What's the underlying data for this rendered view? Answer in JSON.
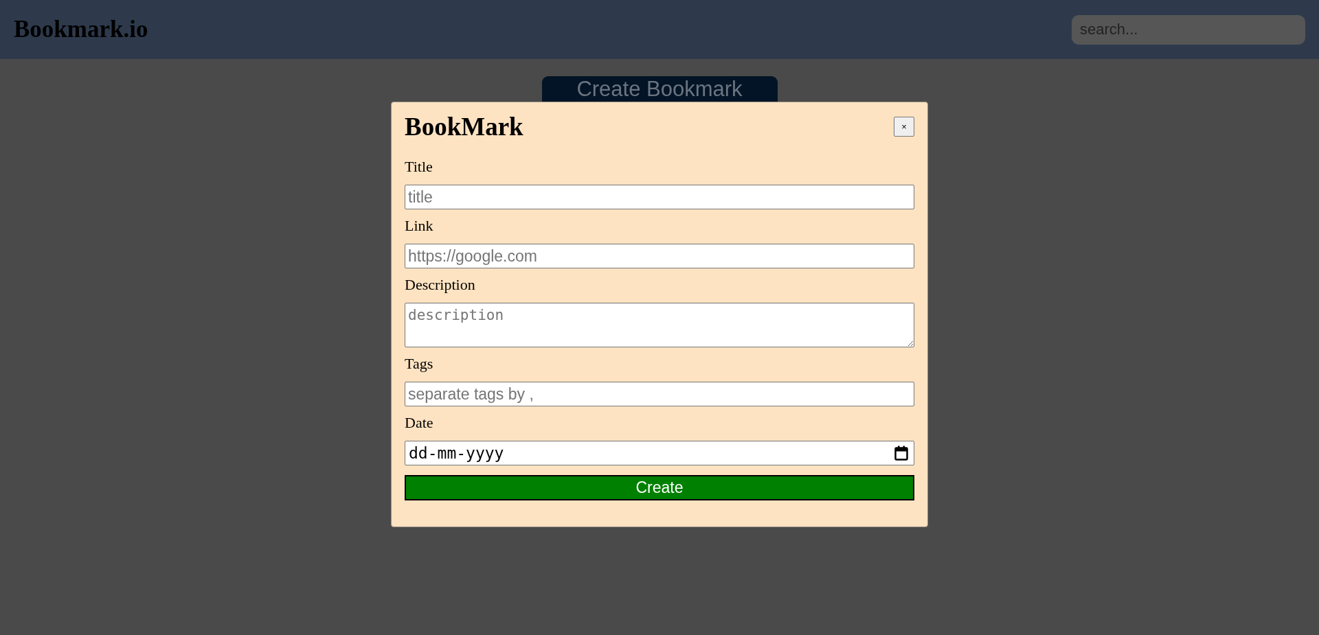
{
  "header": {
    "brand": "Bookmark.io",
    "search": {
      "placeholder": "search..."
    }
  },
  "create_button": "Create Bookmark",
  "modal": {
    "title": "BookMark",
    "close": "×",
    "fields": [
      {
        "kind": "text",
        "label": "Title",
        "placeholder": "title"
      },
      {
        "kind": "text",
        "label": "Link",
        "placeholder": "https://google.com"
      },
      {
        "kind": "textarea",
        "label": "Description",
        "placeholder": "description"
      },
      {
        "kind": "text",
        "label": "Tags",
        "placeholder": "separate tags by ,"
      },
      {
        "kind": "date",
        "label": "Date",
        "value": "dd-mm-yyyy"
      }
    ],
    "submit": "Create"
  }
}
